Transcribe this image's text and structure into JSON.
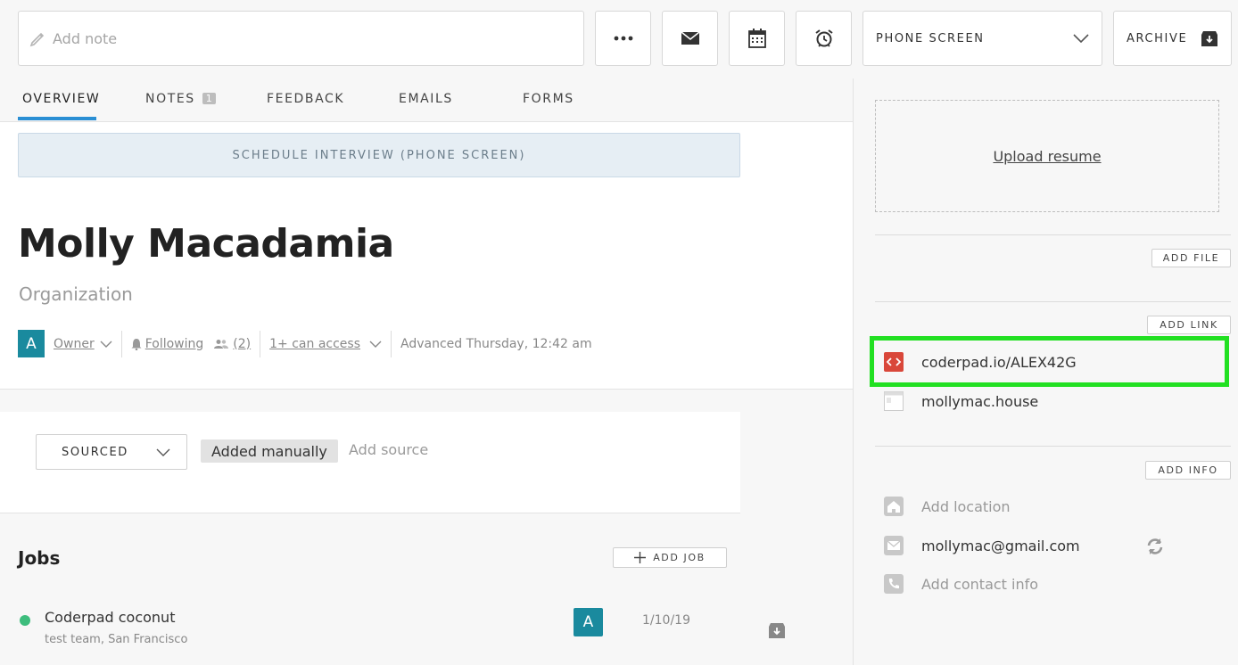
{
  "toolbar": {
    "note_placeholder": "Add note",
    "stage": "PHONE SCREEN",
    "archive_label": "ARCHIVE"
  },
  "tabs": [
    {
      "label": "OVERVIEW",
      "active": true
    },
    {
      "label": "NOTES",
      "badge": "1"
    },
    {
      "label": "FEEDBACK"
    },
    {
      "label": "EMAILS"
    },
    {
      "label": "FORMS"
    }
  ],
  "schedule_button": "SCHEDULE INTERVIEW (PHONE SCREEN)",
  "candidate": {
    "name": "Molly Macadamia",
    "organization": "Organization",
    "avatar_letter": "A",
    "owner_label": "Owner",
    "following_label": "Following",
    "followers_count": "(2)",
    "access_label": "1+ can access",
    "advanced_text": "Advanced Thursday, 12:42 am"
  },
  "source": {
    "origin": "SOURCED",
    "tag": "Added manually",
    "add_source": "Add source"
  },
  "jobs": {
    "title": "Jobs",
    "add_label": "ADD JOB",
    "items": [
      {
        "name": "Coderpad coconut",
        "sub": "test team, San Francisco",
        "avatar": "A",
        "date": "1/10/19",
        "status_color": "#3dbd7d"
      }
    ]
  },
  "sidebar": {
    "upload_label": "Upload resume",
    "add_file": "ADD FILE",
    "add_link": "ADD LINK",
    "links": [
      {
        "text": "coderpad.io/ALEX42G",
        "icon": "coderpad-icon",
        "highlighted": true
      },
      {
        "text": "mollymac.house",
        "icon": "webpage-icon"
      }
    ],
    "add_info": "ADD INFO",
    "info": [
      {
        "text": "Add location",
        "icon": "home-icon",
        "placeholder": true
      },
      {
        "text": "mollymac@gmail.com",
        "icon": "email-icon",
        "placeholder": false
      },
      {
        "text": "Add contact info",
        "icon": "phone-icon",
        "placeholder": true
      }
    ]
  },
  "colors": {
    "accent": "#2a8fd4",
    "avatar": "#1a8a9e",
    "highlight": "#22e022",
    "job_status": "#3dbd7d"
  }
}
